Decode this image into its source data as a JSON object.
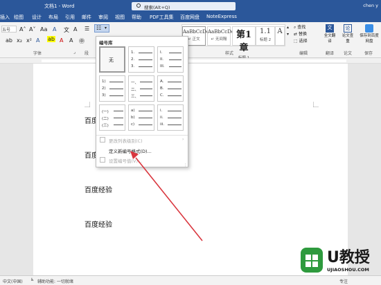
{
  "titlebar": {
    "doc_title": "文档1 - Word",
    "search_placeholder": "搜索(Alt+Q)",
    "user": "chen y"
  },
  "tabs": [
    "插入",
    "绘图",
    "设计",
    "布局",
    "引用",
    "邮件",
    "审阅",
    "视图",
    "帮助",
    "PDF工具集",
    "百度网盘",
    "NoteExpress"
  ],
  "ribbon": {
    "font_group": "字体",
    "paragraph_group": "段",
    "styles_group": "样式",
    "editing_group": "编辑",
    "styles": [
      {
        "preview": "AaBbCcDc",
        "label": "↵ 正文"
      },
      {
        "preview": "AaBbCcDc",
        "label": "↵ 无间隔"
      },
      {
        "preview": "第1章",
        "label": "标题 1"
      },
      {
        "preview": "1.1",
        "label": "标题 2"
      },
      {
        "preview": "A",
        "label": ""
      }
    ],
    "find": "查找",
    "replace": "替换",
    "select": "选择",
    "translate": "全文翻译",
    "paper_check": "论文查重",
    "save_to_baidu": "保存到百度网盘",
    "translate_group": "翻译",
    "paper_group": "论文",
    "save_group": "保存"
  },
  "dropdown": {
    "title": "编号库",
    "none_label": "无",
    "cells": [
      [
        "1.",
        "2.",
        "3."
      ],
      [
        "I.",
        "II.",
        "III."
      ],
      [
        "1)",
        "2)",
        "3)"
      ],
      [
        "一、",
        "二、",
        "三、"
      ],
      [
        "A.",
        "B.",
        "C."
      ],
      [
        "(一)",
        "(二)",
        "(三)"
      ],
      [
        "a)",
        "b)",
        "c)"
      ],
      [
        "i.",
        "ii.",
        "iii."
      ]
    ],
    "change_level": "更改列表级别(C)",
    "define_new": "定义新编号格式(D)...",
    "set_value": "设置编号值(V)..."
  },
  "document": {
    "paragraphs": [
      "百度经验",
      "百度经验",
      "百度经验",
      "百度经验"
    ]
  },
  "statusbar": {
    "lang": "中文(中国)",
    "accessibility": "辅助功能: 一切就绪",
    "focus": "专注"
  },
  "watermark": {
    "brand": "U教授",
    "url": "UJIAOSHOU.COM"
  },
  "colors": {
    "accent": "#2b579a",
    "arrow": "#d9363e",
    "watermark_green": "#2e9a3e"
  }
}
